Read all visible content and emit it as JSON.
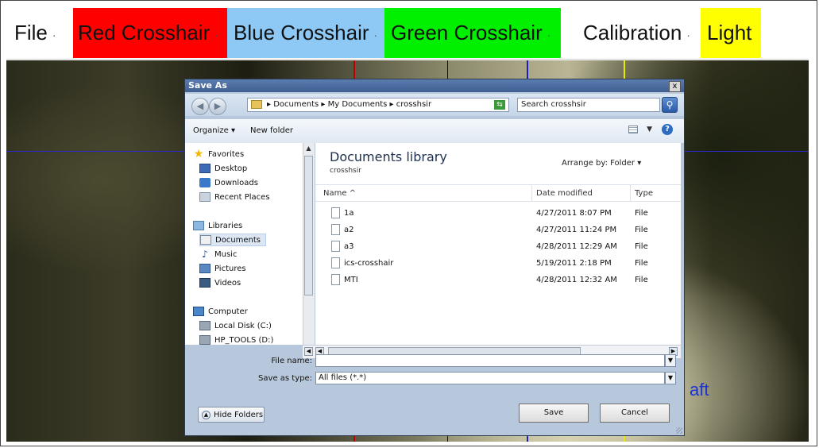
{
  "menubar": {
    "file": "File",
    "red": "Red Crosshair",
    "blue": "Blue Crosshair",
    "green": "Green Crosshair",
    "calibration": "Calibration",
    "light": "Light",
    "arrow": "·",
    "colors": {
      "red": "#ff0000",
      "blue": "#8ec9f6",
      "green": "#00f000",
      "yellow": "#ffff00"
    }
  },
  "camera": {
    "overlay_text": "aft",
    "crosshair_colors": {
      "red": "#c00000",
      "blue": "#2020c0",
      "yellow": "#e8e800"
    }
  },
  "dialog": {
    "title": "Save As",
    "close": "x",
    "address": {
      "breadcrumb": "▸ Documents ▸ My Documents ▸ crosshsir",
      "search_placeholder": "Search crosshsir"
    },
    "toolbar": {
      "organize": "Organize ▾",
      "new_folder": "New folder",
      "help": "?"
    },
    "nav": {
      "favorites": "Favorites",
      "desktop": "Desktop",
      "downloads": "Downloads",
      "recent": "Recent Places",
      "libraries": "Libraries",
      "documents": "Documents",
      "music": "Music",
      "pictures": "Pictures",
      "videos": "Videos",
      "computer": "Computer",
      "local_disk": "Local Disk (C:)",
      "hp_tools": "HP_TOOLS (D:)"
    },
    "library": {
      "title": "Documents library",
      "subtitle": "crosshsir",
      "arrange": "Arrange by:  Folder ▾"
    },
    "columns": {
      "name": "Name  ^",
      "date": "Date modified",
      "type": "Type"
    },
    "files": [
      {
        "name": "1a",
        "date": "4/27/2011 8:07 PM",
        "type": "File"
      },
      {
        "name": "a2",
        "date": "4/27/2011 11:24 PM",
        "type": "File"
      },
      {
        "name": "a3",
        "date": "4/28/2011 12:29 AM",
        "type": "File"
      },
      {
        "name": "ics-crosshair",
        "date": "5/19/2011 2:18 PM",
        "type": "File"
      },
      {
        "name": "MTI",
        "date": "4/28/2011 12:32 AM",
        "type": "File"
      }
    ],
    "form": {
      "file_name_label": "File name:",
      "file_name_value": "",
      "save_type_label": "Save as type:",
      "save_type_value": "All files (*.*)"
    },
    "hide_folders": "Hide Folders",
    "save": "Save",
    "cancel": "Cancel"
  }
}
